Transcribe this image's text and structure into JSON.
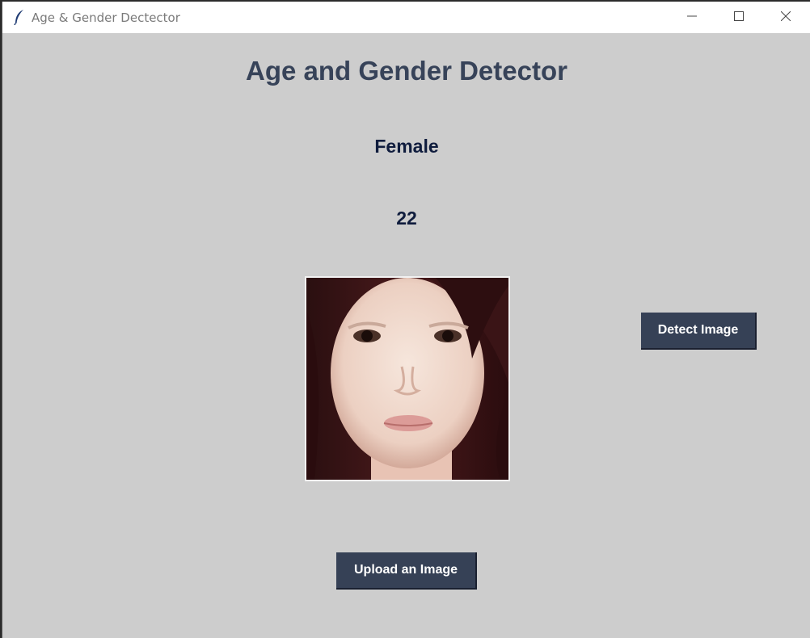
{
  "window": {
    "title": "Age & Gender Dectector",
    "app_icon": "feather-icon",
    "controls": {
      "minimize_icon": "minimize-icon",
      "maximize_icon": "maximize-icon",
      "close_icon": "close-icon"
    }
  },
  "main": {
    "heading": "Age and Gender Detector",
    "gender_result": "Female",
    "age_result": "22",
    "image": {
      "description_icon": "face-photo"
    },
    "buttons": {
      "detect_label": "Detect Image",
      "upload_label": "Upload an Image"
    }
  },
  "colors": {
    "background": "#cdcdcd",
    "heading": "#374359",
    "result_text": "#0f1c3d",
    "button_bg": "#364156",
    "button_text": "#ffffff"
  }
}
